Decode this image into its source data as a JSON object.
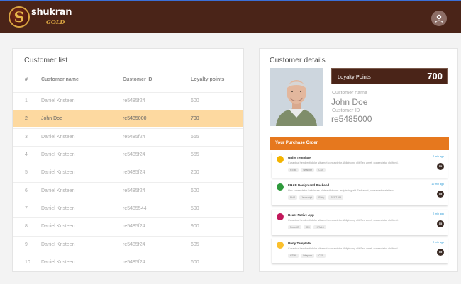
{
  "header": {
    "brand_name": "shukran",
    "brand_sub": "GOLD",
    "logo_letter": "S",
    "user_icon": "user-icon",
    "colors": {
      "bar": "#4a2418",
      "accent": "#d9a441"
    }
  },
  "customer_list": {
    "title": "Customer list",
    "columns": [
      "#",
      "Customer name",
      "Customer ID",
      "Loyalty points"
    ],
    "rows": [
      {
        "num": "1",
        "name": "Daniel Kristeen",
        "id": "re5485f24",
        "points": "600"
      },
      {
        "num": "2",
        "name": "John Doe",
        "id": "re5485000",
        "points": "700",
        "selected": true
      },
      {
        "num": "3",
        "name": "Daniel Kristeen",
        "id": "re5485f24",
        "points": "565"
      },
      {
        "num": "4",
        "name": "Daniel Kristeen",
        "id": "re5485f24",
        "points": "555"
      },
      {
        "num": "5",
        "name": "Daniel Kristeen",
        "id": "re5485f24",
        "points": "200"
      },
      {
        "num": "6",
        "name": "Daniel Kristeen",
        "id": "re5485f24",
        "points": "600"
      },
      {
        "num": "7",
        "name": "Daniel Kristeen",
        "id": "re5485544",
        "points": "500"
      },
      {
        "num": "8",
        "name": "Daniel Kristeen",
        "id": "re5485f24",
        "points": "900"
      },
      {
        "num": "9",
        "name": "Daniel Kristeen",
        "id": "re5485f24",
        "points": "605"
      },
      {
        "num": "10",
        "name": "Daniel Kristeen",
        "id": "re5485f24",
        "points": "600"
      }
    ],
    "selected_color": "#fdd9a0"
  },
  "customer_details": {
    "title": "Customer details",
    "loyalty_label": "Loyalty Points",
    "loyalty_value": "700",
    "name_label": "Customer name",
    "name_value": "John Doe",
    "id_label": "Customer ID",
    "id_value": "re5485000"
  },
  "purchase_order": {
    "title": "Your Purchase Order",
    "header_color": "#e6781e",
    "items": [
      {
        "title": "Unify Template",
        "desc": "Curabitur hendrerit dolor sit amet consectetur. Adipiscing elit Sed amet, consectetur eleifend.",
        "tags": [
          "HTML",
          "Wrapper",
          "CSS"
        ],
        "time": "2 min ago",
        "badge": "55",
        "icon_color": "#f4b400"
      },
      {
        "title": "EHAB Design and Backend",
        "desc": "Hac consectetur habitasse platea dictumst. adipiscing elit Sed amet, consectetur eleifend.",
        "tags": [
          "PHP",
          "Javascript",
          "Ruby",
          "REST API"
        ],
        "time": "10 min ago",
        "badge": "55",
        "icon_color": "#2e9a3c"
      },
      {
        "title": "React Native App",
        "desc": "Curabitur hendrerit dolor sit amet consectetur. Adipiscing elit Sed amet, consectetur eleifend.",
        "tags": [
          "ReactJS",
          "iOS",
          "HTML5"
        ],
        "time": "2 min ago",
        "badge": "55",
        "icon_color": "#c2185b"
      },
      {
        "title": "Unify Template",
        "desc": "Curabitur hendrerit dolor sit amet consectetur. Adipiscing elit Sed amet, consectetur eleifend.",
        "tags": [
          "HTML",
          "Wrapper",
          "CSS"
        ],
        "time": "2 min ago",
        "badge": "55",
        "icon_color": "#fbc02d"
      }
    ]
  }
}
